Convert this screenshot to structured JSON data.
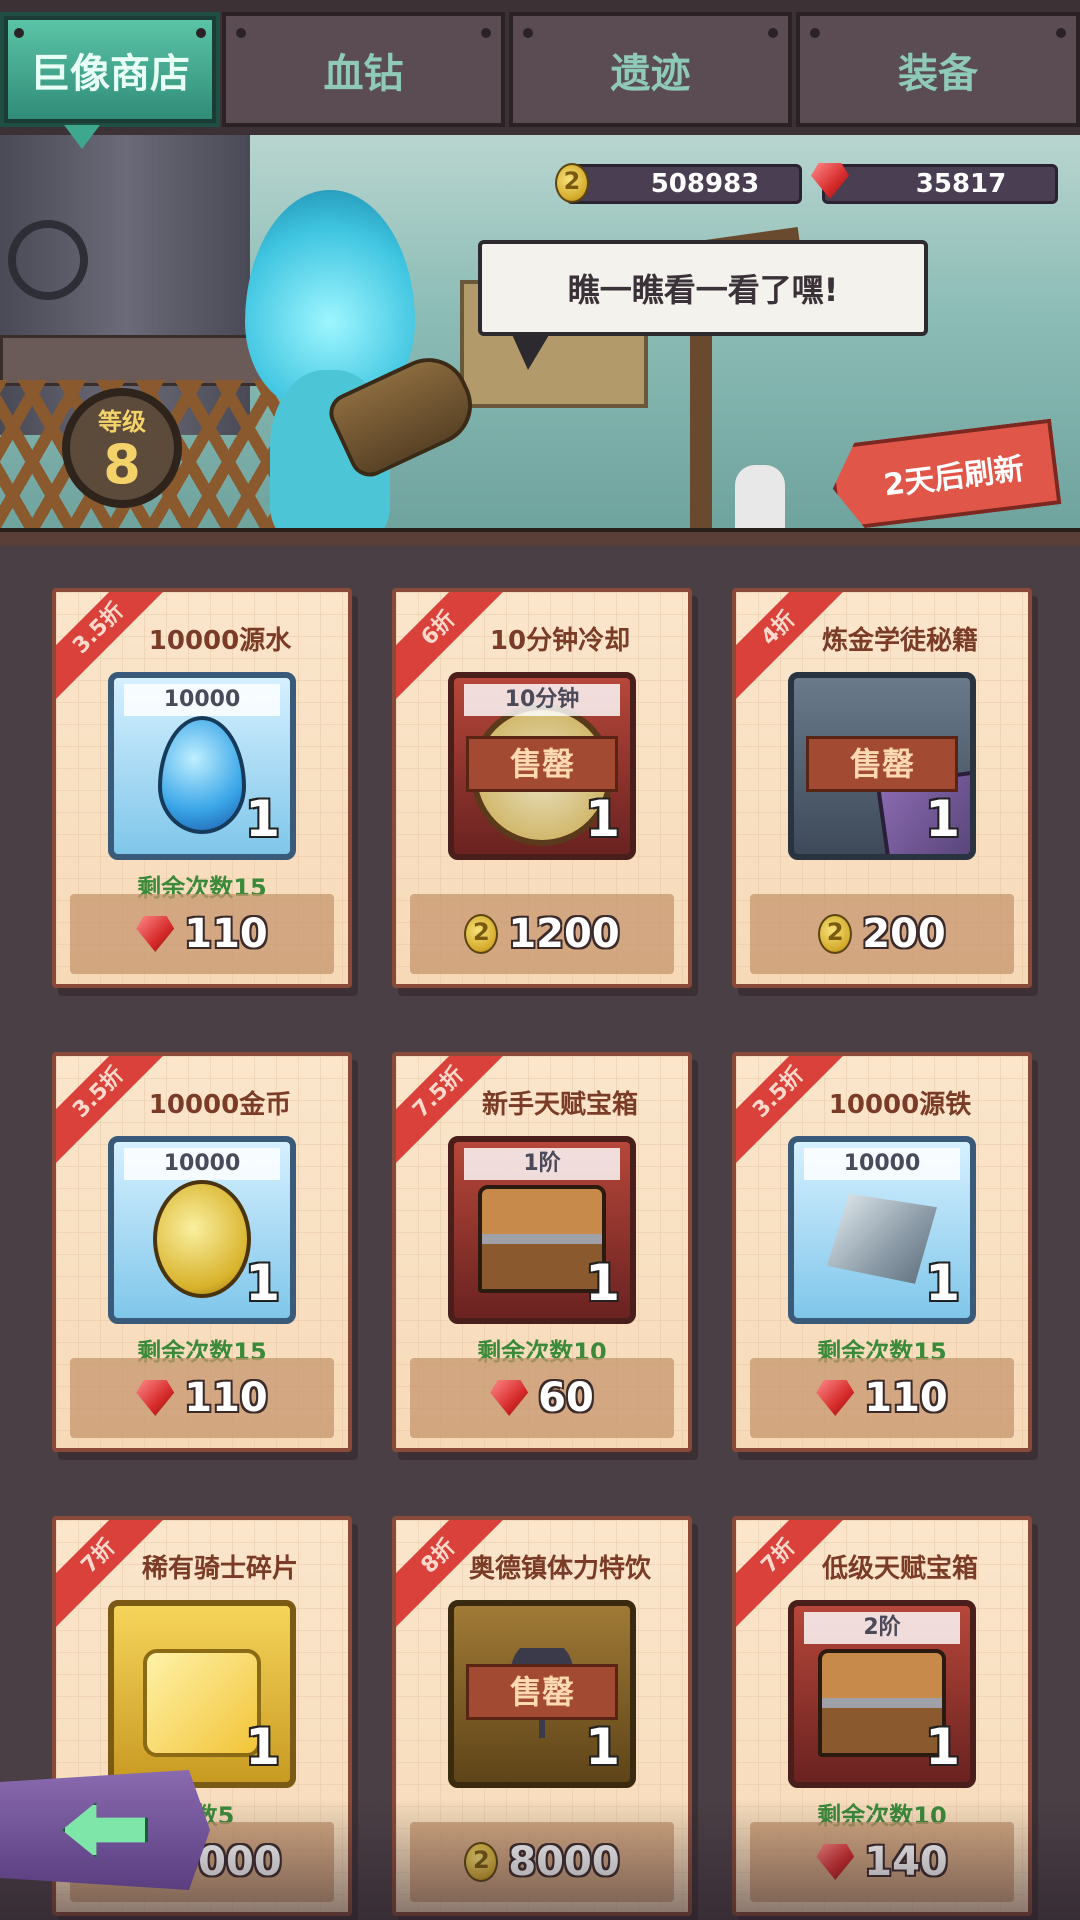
{
  "tabs": [
    {
      "label": "巨像商店",
      "active": true
    },
    {
      "label": "血钻",
      "active": false
    },
    {
      "label": "遗迹",
      "active": false
    },
    {
      "label": "装备",
      "active": false
    }
  ],
  "currencies": {
    "gold": {
      "icon": "gold-coin-icon",
      "value": "508983"
    },
    "gem": {
      "icon": "red-gem-icon",
      "value": "35817"
    }
  },
  "speech": "瞧一瞧看一看了嘿!",
  "level": {
    "label": "等级",
    "value": "8"
  },
  "refresh": "2天后刷新",
  "items": [
    {
      "discount": "3.5折",
      "name": "10000源水",
      "qty_label": "10000",
      "count": "1",
      "sold_out": false,
      "remaining": "剩余次数15",
      "currency": "gem",
      "price": "110",
      "art": "water-drop-icon"
    },
    {
      "discount": "6折",
      "name": "10分钟冷却",
      "qty_label": "10分钟",
      "count": "1",
      "sold_out": true,
      "sold_label": "售罄",
      "remaining": "",
      "currency": "gold",
      "price": "1200",
      "art": "clock-icon"
    },
    {
      "discount": "4折",
      "name": "炼金学徒秘籍",
      "qty_label": "",
      "count": "1",
      "sold_out": true,
      "sold_label": "售罄",
      "remaining": "",
      "currency": "gold",
      "price": "200",
      "art": "book-icon"
    },
    {
      "discount": "3.5折",
      "name": "10000金币",
      "qty_label": "10000",
      "count": "1",
      "sold_out": false,
      "remaining": "剩余次数15",
      "currency": "gem",
      "price": "110",
      "art": "gold-coin-icon"
    },
    {
      "discount": "7.5折",
      "name": "新手天赋宝箱",
      "qty_label": "1阶",
      "count": "1",
      "sold_out": false,
      "remaining": "剩余次数10",
      "currency": "gem",
      "price": "60",
      "art": "chest-icon"
    },
    {
      "discount": "3.5折",
      "name": "10000源铁",
      "qty_label": "10000",
      "count": "1",
      "sold_out": false,
      "remaining": "剩余次数15",
      "currency": "gem",
      "price": "110",
      "art": "iron-ore-icon"
    },
    {
      "discount": "7折",
      "name": "稀有骑士碎片",
      "qty_label": "",
      "count": "1",
      "sold_out": false,
      "remaining": "次数5",
      "currency": "gem",
      "price": "9000",
      "art": "puzzle-piece-icon"
    },
    {
      "discount": "8折",
      "name": "奥德镇体力特饮",
      "qty_label": "",
      "count": "1",
      "sold_out": true,
      "sold_label": "售罄",
      "remaining": "",
      "currency": "gold",
      "price": "8000",
      "art": "umbrella-drink-icon"
    },
    {
      "discount": "7折",
      "name": "低级天赋宝箱",
      "qty_label": "2阶",
      "count": "1",
      "sold_out": false,
      "remaining": "剩余次数10",
      "currency": "gem",
      "price": "140",
      "art": "chest-icon"
    }
  ],
  "back_icon": "back-arrow-icon",
  "colors": {
    "accent": "#5cc6a8",
    "ribbon": "#d9413a",
    "remaining_text": "#3b8a3a",
    "sold_out": "#a34a32"
  }
}
